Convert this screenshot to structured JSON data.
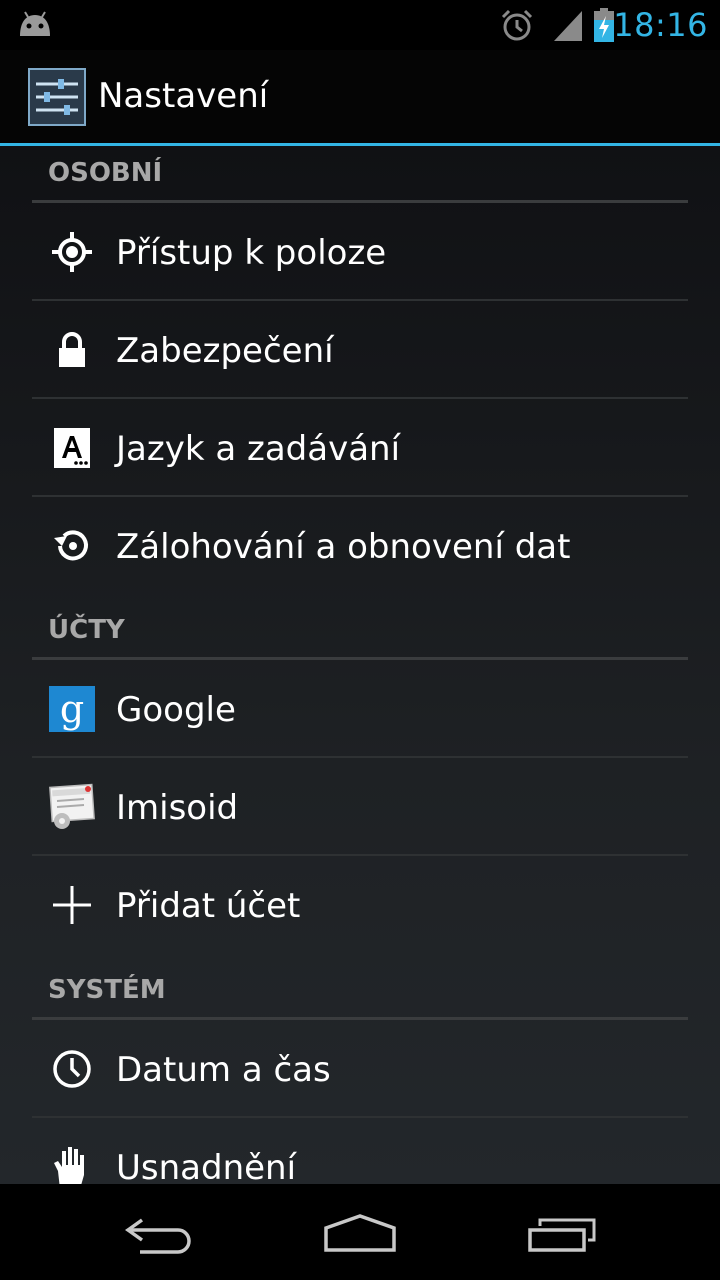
{
  "status_bar": {
    "time": "18:16",
    "icons": [
      "android-icon",
      "alarm-icon",
      "signal-icon",
      "battery-charging-icon"
    ],
    "accent_color": "#33b5e5"
  },
  "action_bar": {
    "title": "Nastavení",
    "icon": "settings-sliders-icon"
  },
  "sections": {
    "personal": {
      "header": "OSOBNÍ",
      "items": [
        {
          "label": "Přístup k poloze",
          "icon": "location-icon"
        },
        {
          "label": "Zabezpečení",
          "icon": "lock-icon"
        },
        {
          "label": "Jazyk a zadávání",
          "icon": "language-icon"
        },
        {
          "label": "Zálohování a obnovení dat",
          "icon": "backup-restore-icon"
        }
      ]
    },
    "accounts": {
      "header": "ÚČTY",
      "items": [
        {
          "label": "Google",
          "icon": "google-icon"
        },
        {
          "label": "Imisoid",
          "icon": "imisoid-icon"
        },
        {
          "label": "Přidat účet",
          "icon": "plus-icon"
        }
      ]
    },
    "system": {
      "header": "SYSTÉM",
      "items": [
        {
          "label": "Datum a čas",
          "icon": "clock-icon"
        },
        {
          "label": "Usnadnění",
          "icon": "hand-icon"
        }
      ]
    }
  },
  "nav_bar": {
    "buttons": [
      "back-icon",
      "home-icon",
      "recent-apps-icon"
    ]
  }
}
